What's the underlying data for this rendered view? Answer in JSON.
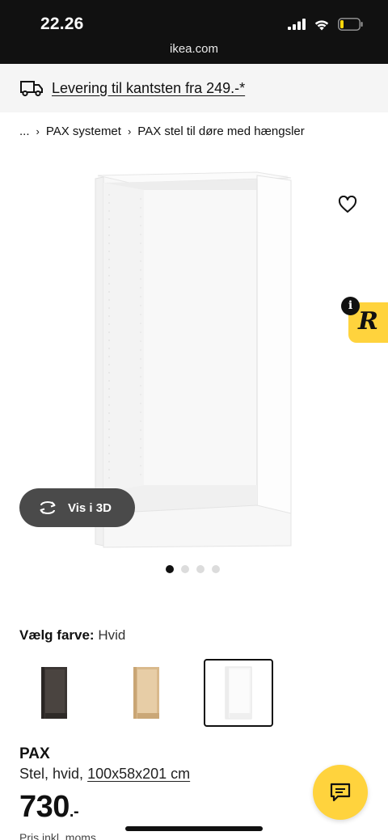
{
  "status_bar": {
    "time": "22.26",
    "url": "ikea.com"
  },
  "delivery_banner": {
    "text": "Levering til kantsten fra 249.-*"
  },
  "breadcrumb": {
    "ellipsis": "...",
    "items": [
      "PAX systemet",
      "PAX stel til døre med hængsler"
    ]
  },
  "gallery": {
    "view_3d_label": "Vis i 3D",
    "image_count": 4,
    "active_index": 0
  },
  "reviews_badge": {
    "letter": "R",
    "info": "i"
  },
  "color": {
    "label": "Vælg farve:",
    "value": "Hvid",
    "options": [
      "sortbrun",
      "hvidbejdset egetræseffekt",
      "hvid"
    ],
    "selected_index": 2
  },
  "product": {
    "name": "PAX",
    "description": "Stel, hvid,",
    "dimensions": "100x58x201 cm",
    "price": "730",
    "price_suffix": ".-",
    "price_note": "Pris inkl. moms"
  },
  "colors": {
    "accent_yellow": "#ffd33d",
    "status_bar_bg": "#111111",
    "banner_bg": "#f5f5f5"
  }
}
